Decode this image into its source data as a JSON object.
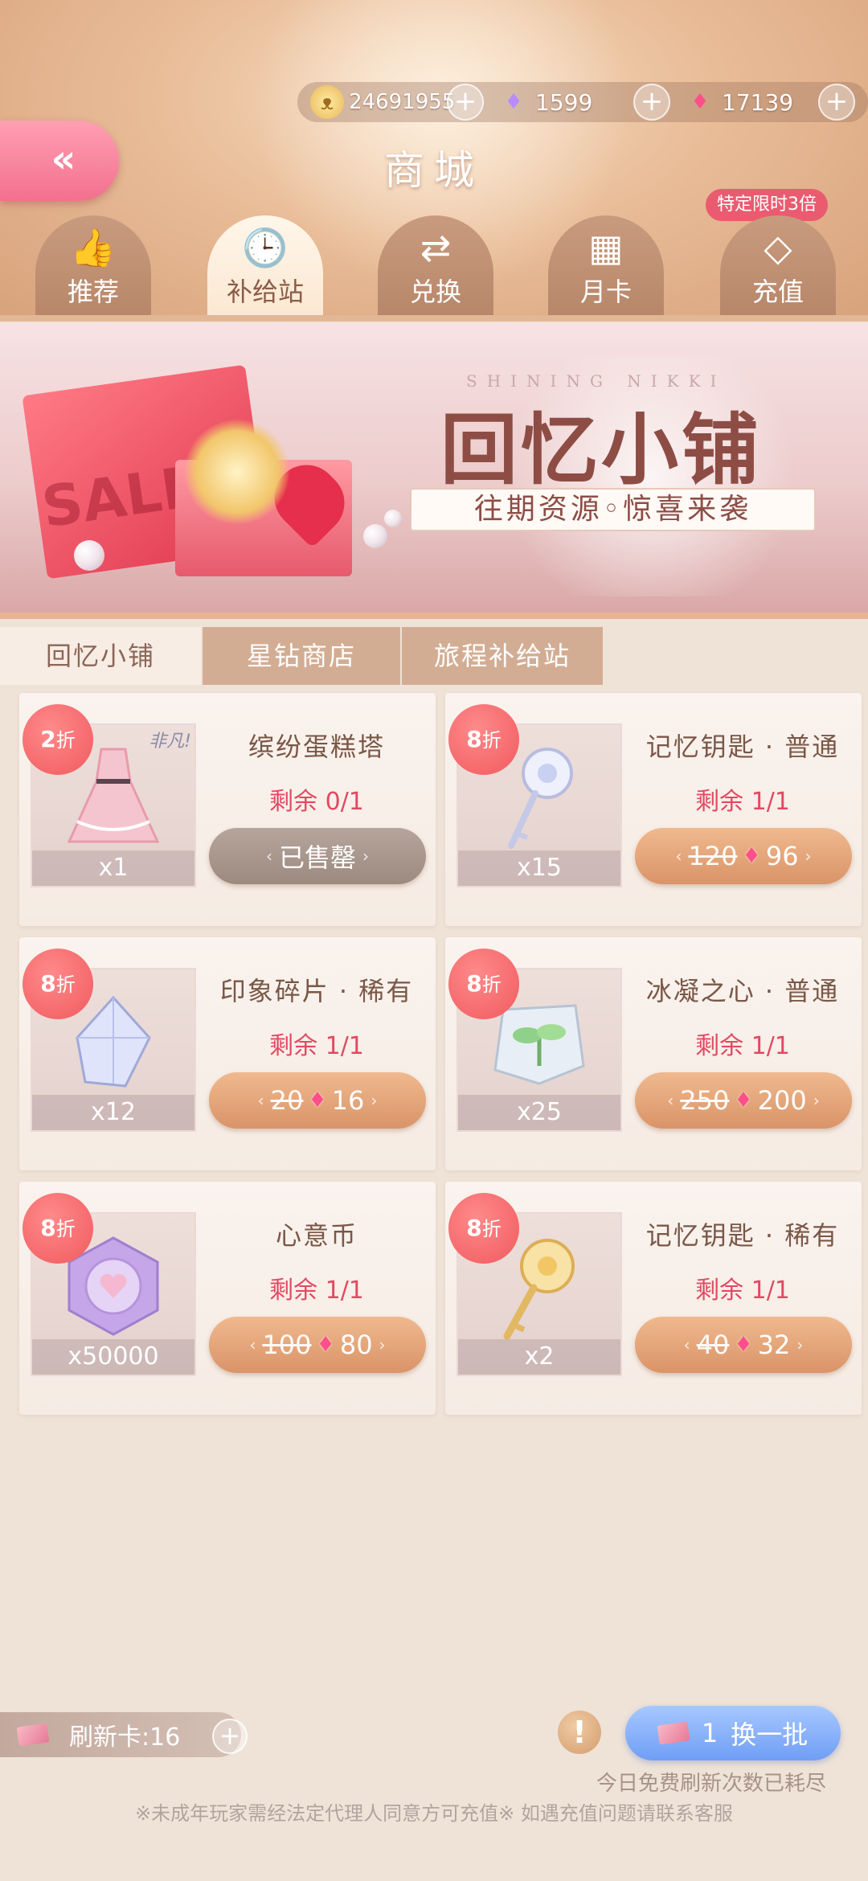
{
  "currency": {
    "gold": "24691955",
    "diamond": "1599",
    "star_diamond": "17139"
  },
  "header": {
    "title": "商城",
    "promo_badge": "特定限时3倍",
    "tabs": [
      {
        "label": "推荐",
        "icon": "thumbs-up-icon"
      },
      {
        "label": "补给站",
        "icon": "gift-clock-icon",
        "active": true
      },
      {
        "label": "兑换",
        "icon": "exchange-icon"
      },
      {
        "label": "月卡",
        "icon": "calendar-icon"
      },
      {
        "label": "充值",
        "icon": "diamond-icon"
      }
    ]
  },
  "banner": {
    "brand": "SHINING NIKKI",
    "title": "回忆小铺",
    "slogan": "往期资源◦惊喜来袭",
    "sale": "SALE"
  },
  "subtabs": [
    {
      "label": "回忆小铺",
      "active": true
    },
    {
      "label": "星钻商店"
    },
    {
      "label": "旅程补给站"
    }
  ],
  "items": [
    {
      "name": "缤纷蛋糕塔",
      "discount": "2",
      "discount_unit": "折",
      "stock": "剩余 0/1",
      "qty": "x1",
      "sold_out": true,
      "sold_label": "已售罄",
      "tag": "非凡!"
    },
    {
      "name": "记忆钥匙 · 普通",
      "discount": "8",
      "discount_unit": "折",
      "stock": "剩余 1/1",
      "qty": "x15",
      "old_price": "120",
      "price": "96"
    },
    {
      "name": "印象碎片 · 稀有",
      "discount": "8",
      "discount_unit": "折",
      "stock": "剩余 1/1",
      "qty": "x12",
      "old_price": "20",
      "price": "16"
    },
    {
      "name": "冰凝之心 · 普通",
      "discount": "8",
      "discount_unit": "折",
      "stock": "剩余 1/1",
      "qty": "x25",
      "old_price": "250",
      "price": "200"
    },
    {
      "name": "心意币",
      "discount": "8",
      "discount_unit": "折",
      "stock": "剩余 1/1",
      "qty": "x50000",
      "old_price": "100",
      "price": "80"
    },
    {
      "name": "记忆钥匙 · 稀有",
      "discount": "8",
      "discount_unit": "折",
      "stock": "剩余 1/1",
      "qty": "x2",
      "old_price": "40",
      "price": "32"
    }
  ],
  "footer": {
    "refresh_card": "刷新卡:16",
    "swap_count": "1",
    "swap_label": "换一批",
    "free_note": "今日免费刷新次数已耗尽",
    "legal_note": "※未成年玩家需经法定代理人同意方可充值※ 如遇充值问题请联系客服"
  },
  "colors": {
    "accent_pink": "#f2708e",
    "price_orange": "#d99468",
    "stock_red": "#e14a62",
    "swap_blue": "#6f9ef5"
  }
}
